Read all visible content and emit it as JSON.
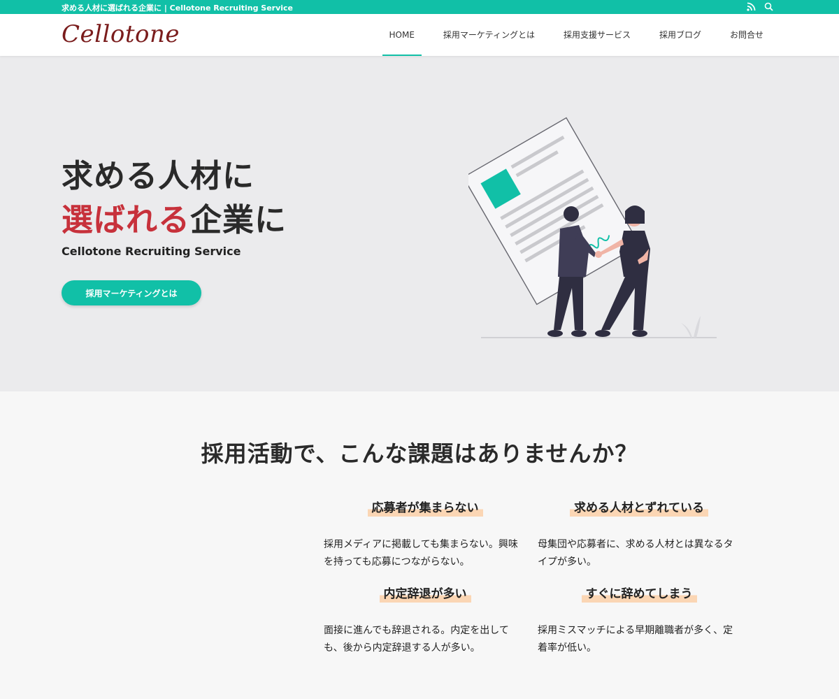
{
  "topbar": {
    "title": "求める人材に選ばれる企業に | Cellotone Recruiting Service",
    "icons": [
      "rss-icon",
      "search-icon"
    ]
  },
  "header": {
    "logo": "Cellotone",
    "nav": [
      {
        "label": "HOME",
        "active": true
      },
      {
        "label": "採用マーケティングとは",
        "active": false
      },
      {
        "label": "採用支援サービス",
        "active": false
      },
      {
        "label": "採用ブログ",
        "active": false
      },
      {
        "label": "お問合せ",
        "active": false
      }
    ]
  },
  "hero": {
    "line1": "求める人材に",
    "line2_accent": "選ばれる",
    "line2_rest": "企業に",
    "subtitle": "Cellotone Recruiting Service",
    "cta": "採用マーケティングとは"
  },
  "issues": {
    "title": "採用活動で、こんな課題はありませんか？",
    "items": [
      {
        "heading": "応募者が集まらない",
        "body": "採用メディアに掲載しても集まらない。興味を持っても応募につながらない。"
      },
      {
        "heading": "求める人材とずれている",
        "body": "母集団や応募者に、求める人材とは異なるタイプが多い。"
      },
      {
        "heading": "内定辞退が多い",
        "body": "面接に進んでも辞退される。内定を出しても、後から内定辞退する人が多い。"
      },
      {
        "heading": "すぐに辞めてしまう",
        "body": "採用ミスマッチによる早期離職者が多く、定着率が低い。"
      }
    ]
  },
  "colors": {
    "accent": "#11c0a7",
    "highlight_red": "#c7313b",
    "logo": "#7a1c1c",
    "marker": "#fbd6b4"
  }
}
